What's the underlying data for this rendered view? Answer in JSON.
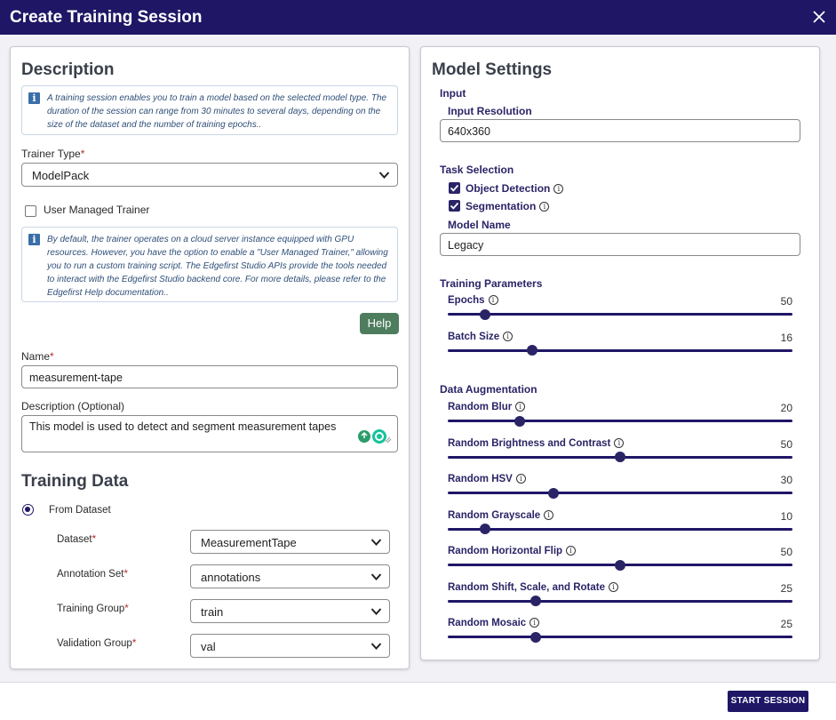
{
  "dialog": {
    "title": "Create Training Session"
  },
  "description_panel": {
    "heading": "Description",
    "info_text": "A training session enables you to train a model based on the selected model type. The duration of the session can range from 30 minutes to several days, depending on the size of the dataset and the number of training epochs..",
    "trainer_type_label": "Trainer Type",
    "required_mark": "*",
    "trainer_type_value": "ModelPack",
    "user_managed_label": "User Managed Trainer",
    "user_managed_checked": false,
    "trainer_info_text": "By default, the trainer operates on a cloud server instance equipped with GPU resources. However, you have the option to enable a \"User Managed Trainer,\" allowing you to run a custom training script. The Edgefirst Studio APIs provide the tools needed to interact with the Edgefirst Studio backend core. For more details, please refer to the Edgefirst Help documentation..",
    "help_label": "Help",
    "name_label": "Name",
    "name_value": "measurement-tape",
    "desc_label": "Description (Optional)",
    "desc_value": "This model is used to detect and segment measurement tapes"
  },
  "training_data": {
    "heading": "Training Data",
    "from_dataset_label": "From Dataset",
    "dataset_label": "Dataset",
    "dataset_value": "MeasurementTape",
    "annotation_label": "Annotation Set",
    "annotation_value": "annotations",
    "training_group_label": "Training Group",
    "training_group_value": "train",
    "validation_group_label": "Validation Group",
    "validation_group_value": "val"
  },
  "model_settings": {
    "heading": "Model Settings",
    "input_section": "Input",
    "input_resolution_label": "Input Resolution",
    "input_resolution_value": "640x360",
    "task_section": "Task Selection",
    "task_object_detection": "Object Detection",
    "task_segmentation": "Segmentation",
    "model_name_label": "Model Name",
    "model_name_value": "Legacy",
    "training_params_section": "Training Parameters",
    "data_aug_section": "Data Augmentation",
    "training_sliders": [
      {
        "label": "Epochs",
        "value": "50",
        "fraction": 0.108
      },
      {
        "label": "Batch Size",
        "value": "16",
        "fraction": 0.245
      }
    ],
    "aug_sliders": [
      {
        "label": "Random Blur",
        "value": "20",
        "fraction": 0.21
      },
      {
        "label": "Random Brightness and Contrast",
        "value": "50",
        "fraction": 0.5
      },
      {
        "label": "Random HSV",
        "value": "30",
        "fraction": 0.307
      },
      {
        "label": "Random Grayscale",
        "value": "10",
        "fraction": 0.108
      },
      {
        "label": "Random Horizontal Flip",
        "value": "50",
        "fraction": 0.5
      },
      {
        "label": "Random Shift, Scale, and Rotate",
        "value": "25",
        "fraction": 0.255
      },
      {
        "label": "Random Mosaic",
        "value": "25",
        "fraction": 0.255
      }
    ]
  },
  "footer": {
    "start_label": "START SESSION"
  },
  "colors": {
    "brand": "#1f1666",
    "help_button": "#4e7d5e"
  }
}
